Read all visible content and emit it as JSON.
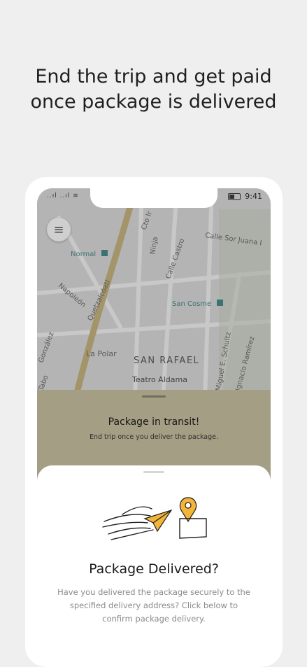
{
  "headline": {
    "line1": "End the trip and get paid",
    "line2": "once package is delivered"
  },
  "status_bar": {
    "time": "9:41",
    "signal_glyph": "..ıl  ..ıl",
    "wifi_glyph": "≋"
  },
  "map": {
    "labels": {
      "normal": "Normal",
      "san_cosme": "San Cosme",
      "la_polar": "La Polar",
      "neighborhood": "SAN RAFAEL",
      "teatro": "Teatro Aldama",
      "calle_sor_juana": "Calle Sor Juana I",
      "calle_castro": "Calle Castro",
      "ninja": "Ninja",
      "cto": "Cto Ir",
      "napoleon": "Napoleón",
      "quetzalcoatl": "Quetzalcóatl",
      "gonzalez": "González",
      "tabo": "Tabo",
      "miguel": "Miguel E. Schultz",
      "ignacio": "Ignacio Ramírez"
    }
  },
  "transit": {
    "title": "Package in transit!",
    "subtitle": "End trip once you deliver the package."
  },
  "sheet": {
    "title": "Package Delivered?",
    "body": "Have you delivered the package securely to the specified delivery address? Click below to confirm package delivery."
  },
  "icons": {
    "menu": "hamburger-icon",
    "illustration": "paper-plane-delivery-illustration"
  },
  "colors": {
    "background": "#efefef",
    "accent": "#f2b53a",
    "transit_panel": "#c9c1a2"
  }
}
